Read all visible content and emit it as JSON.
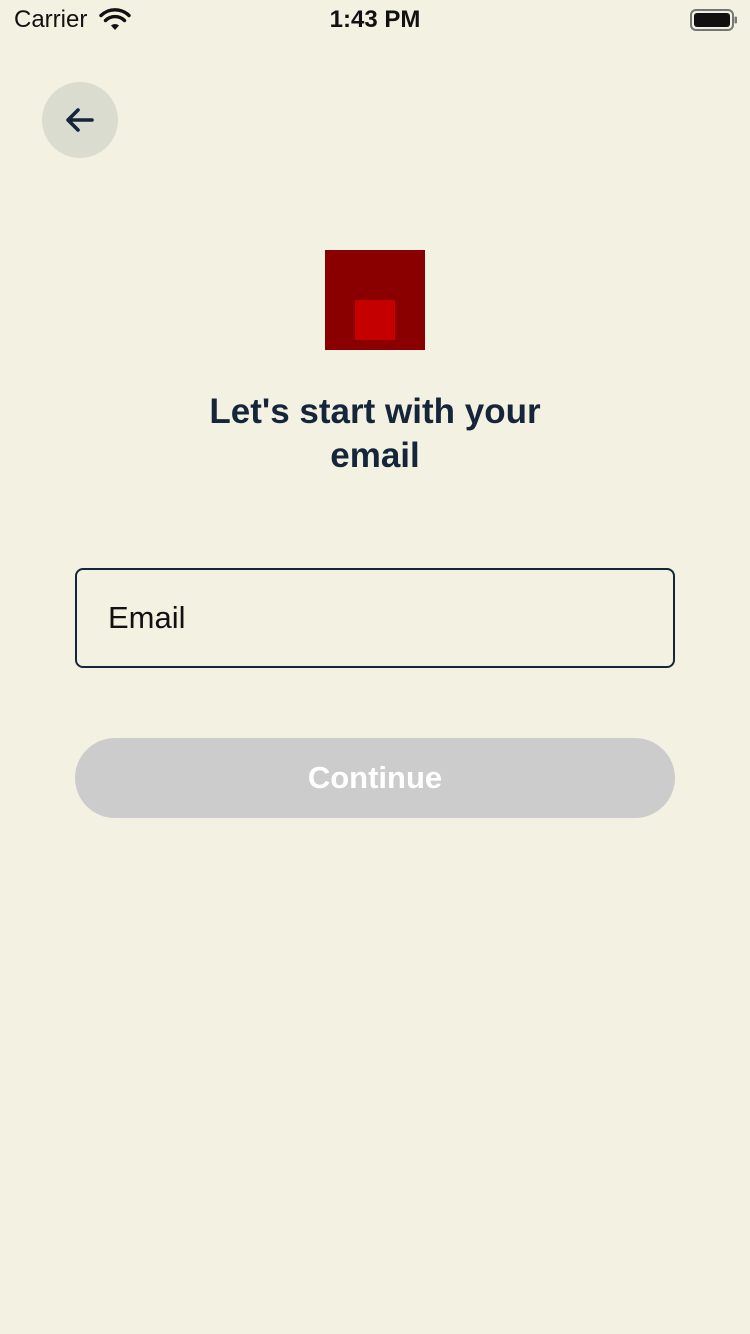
{
  "status_bar": {
    "carrier": "Carrier",
    "time": "1:43 PM",
    "wifi_icon": "wifi-icon",
    "battery_icon": "battery-icon"
  },
  "header": {
    "back_icon": "arrow-left-icon"
  },
  "logo": {
    "outer_color": "#8a0000",
    "inner_color": "#c40000"
  },
  "main": {
    "title": "Let's start with your email",
    "email": {
      "value": "",
      "placeholder": "Email"
    },
    "continue_label": "Continue"
  },
  "colors": {
    "background": "#f3f1e2",
    "text": "#16263a",
    "button_disabled": "#cccccc"
  }
}
